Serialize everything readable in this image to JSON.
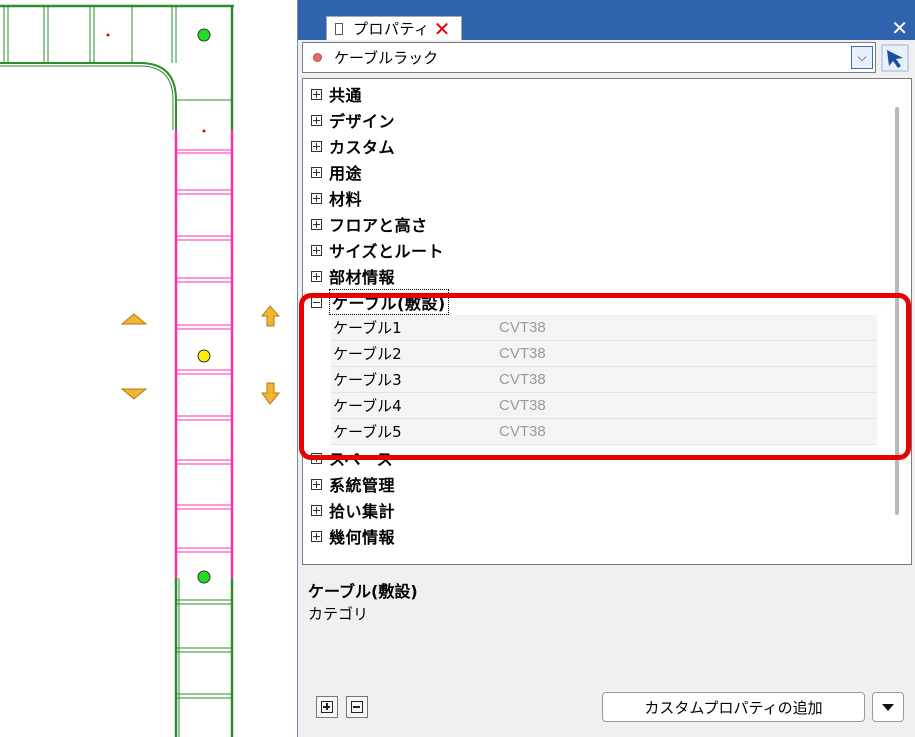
{
  "panel": {
    "tab_title": "プロパティ",
    "close_glyph": "✕",
    "window_close_glyph": "✕",
    "selector": {
      "value": "ケーブルラック",
      "dropdown_glyph": "⌵"
    }
  },
  "tree": {
    "categories_top": [
      {
        "label": "共通",
        "expanded": false
      },
      {
        "label": "デザイン",
        "expanded": false
      },
      {
        "label": "カスタム",
        "expanded": false
      },
      {
        "label": "用途",
        "expanded": false
      },
      {
        "label": "材料",
        "expanded": false
      },
      {
        "label": "フロアと高さ",
        "expanded": false
      },
      {
        "label": "サイズとルート",
        "expanded": false
      },
      {
        "label": "部材情報",
        "expanded": false
      }
    ],
    "expanded_category": {
      "label": "ケーブル(敷設)",
      "expanded": true,
      "properties": [
        {
          "name": "ケーブル1",
          "value": "CVT38"
        },
        {
          "name": "ケーブル2",
          "value": "CVT38"
        },
        {
          "name": "ケーブル3",
          "value": "CVT38"
        },
        {
          "name": "ケーブル4",
          "value": "CVT38"
        },
        {
          "name": "ケーブル5",
          "value": "CVT38"
        }
      ]
    },
    "categories_bottom": [
      {
        "label": "スペース",
        "expanded": false
      },
      {
        "label": "系統管理",
        "expanded": false
      },
      {
        "label": "拾い集計",
        "expanded": false
      },
      {
        "label": "幾何情報",
        "expanded": false
      }
    ]
  },
  "description": {
    "title": "ケーブル(敷設)",
    "text": "カテゴリ"
  },
  "footer": {
    "add_custom_property_label": "カスタムプロパティの追加"
  },
  "colors": {
    "titlebar": "#2f63ad",
    "highlight": "#e80000",
    "cad_green": "#2e8b2e",
    "cad_pink": "#ff2fb0"
  }
}
